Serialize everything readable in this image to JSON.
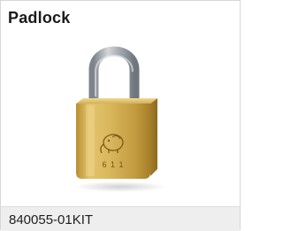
{
  "card": {
    "title": "Padlock",
    "sku": "840055-01KIT",
    "image": {
      "icon": "padlock-image",
      "body_engraving": "6 1 1",
      "emblem_icon": "elephant-logo-icon"
    }
  },
  "colors": {
    "brass_light": "#e6c66f",
    "brass_mid": "#c9a344",
    "brass_dark": "#a27d27",
    "shackle": "#a7adb3",
    "footer_bg": "#eeeeee"
  }
}
